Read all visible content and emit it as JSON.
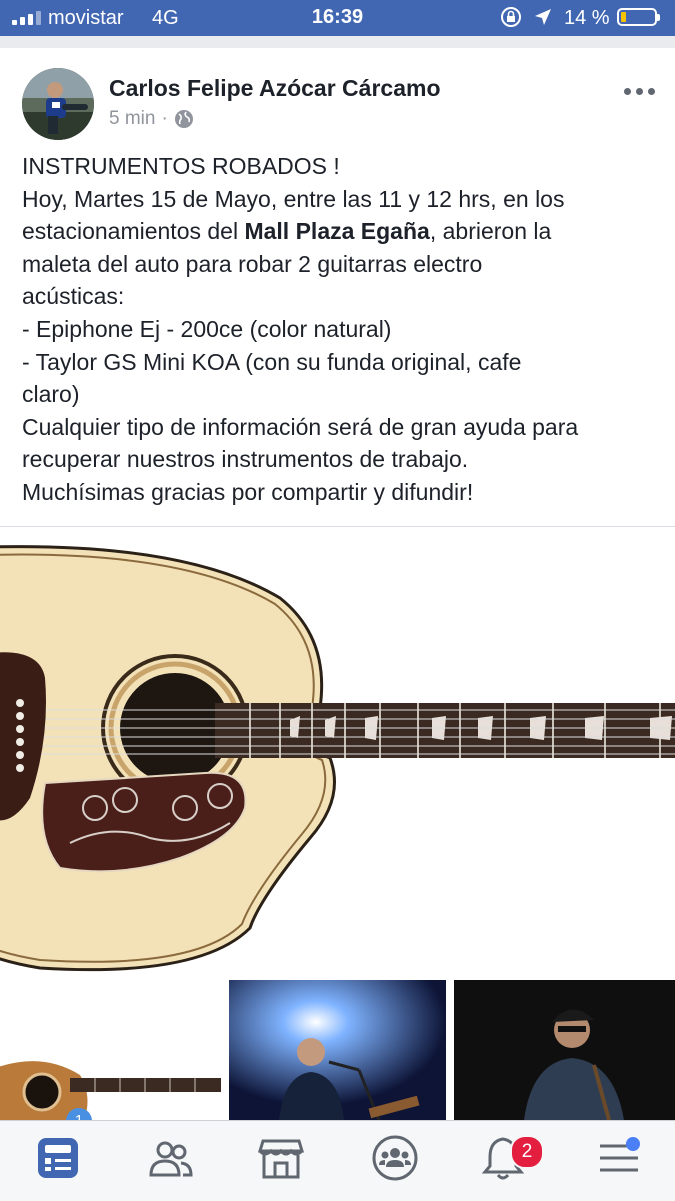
{
  "status_bar": {
    "carrier": "movistar",
    "network": "4G",
    "time": "16:39",
    "battery": "14 %",
    "icons": [
      "signal-icon",
      "orientation-lock-icon",
      "location-icon",
      "battery-icon"
    ]
  },
  "post": {
    "author": "Carlos Felipe Azócar Cárcamo",
    "time_ago": "5 min",
    "separator": "·",
    "privacy_icon": "globe-icon",
    "lines": [
      "INSTRUMENTOS ROBADOS !",
      "Hoy, Martes 15 de Mayo, entre las 11 y 12 hrs, en los",
      "estacionamientos del ",
      "Mall Plaza Egaña",
      ", abrieron la",
      "maleta del auto para robar 2 guitarras electro",
      "acústicas:",
      "- Epiphone Ej - 200ce (color natural)",
      "- Taylor GS Mini KOA (con su funda original, cafe",
      "claro)",
      "Cualquier tipo de información será de gran ayuda para",
      "recuperar nuestros instrumentos de trabajo.",
      "Muchísimas gracias por compartir y difundir!"
    ],
    "thumb_badge": "1"
  },
  "tab_bar": {
    "tabs": [
      "news-feed-icon",
      "friends-icon",
      "marketplace-icon",
      "groups-icon",
      "notifications-icon",
      "menu-icon"
    ],
    "notification_count": "2",
    "colors": {
      "active": "#4267b2",
      "inactive": "#606770"
    }
  }
}
